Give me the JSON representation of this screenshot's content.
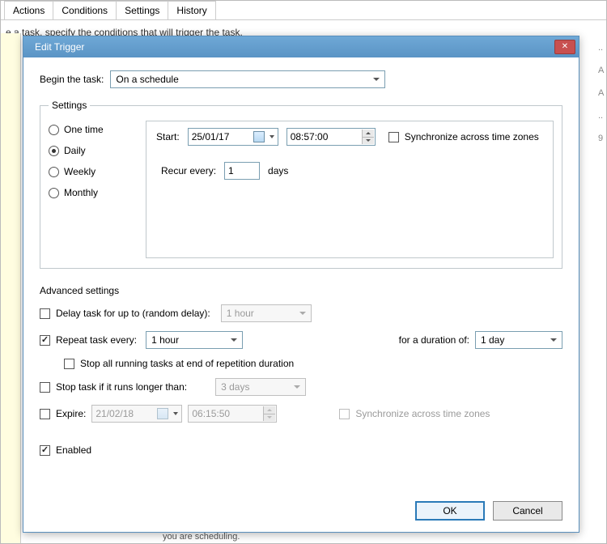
{
  "bg": {
    "tabs": [
      "Actions",
      "Conditions",
      "Settings",
      "History"
    ],
    "blurb": "e a task,            specify the conditions that will trigger the task.",
    "right_hints": [
      "..",
      "A",
      "A",
      "..",
      "9"
    ],
    "bottom": "you are scheduling."
  },
  "dialog": {
    "title": "Edit Trigger",
    "begin_label": "Begin the task:",
    "begin_value": "On a schedule",
    "settings": {
      "legend": "Settings",
      "options": {
        "one_time": "One time",
        "daily": "Daily",
        "weekly": "Weekly",
        "monthly": "Monthly"
      },
      "selected": "daily",
      "start_label": "Start:",
      "start_date": "25/01/17",
      "start_time": "08:57:00",
      "sync_label": "Synchronize across time zones",
      "recur_label": "Recur every:",
      "recur_value": "1",
      "recur_unit": "days"
    },
    "advanced": {
      "legend": "Advanced settings",
      "delay_label": "Delay task for up to (random delay):",
      "delay_value": "1 hour",
      "repeat_label": "Repeat task every:",
      "repeat_value": "1 hour",
      "duration_label": "for a duration of:",
      "duration_value": "1 day",
      "stop_at_end_label": "Stop all running tasks at end of repetition duration",
      "stop_if_longer_label": "Stop task if it runs longer than:",
      "stop_if_longer_value": "3 days",
      "expire_label": "Expire:",
      "expire_date": "21/02/18",
      "expire_time": "06:15:50",
      "expire_sync_label": "Synchronize across time zones",
      "enabled_label": "Enabled"
    },
    "buttons": {
      "ok": "OK",
      "cancel": "Cancel"
    }
  }
}
